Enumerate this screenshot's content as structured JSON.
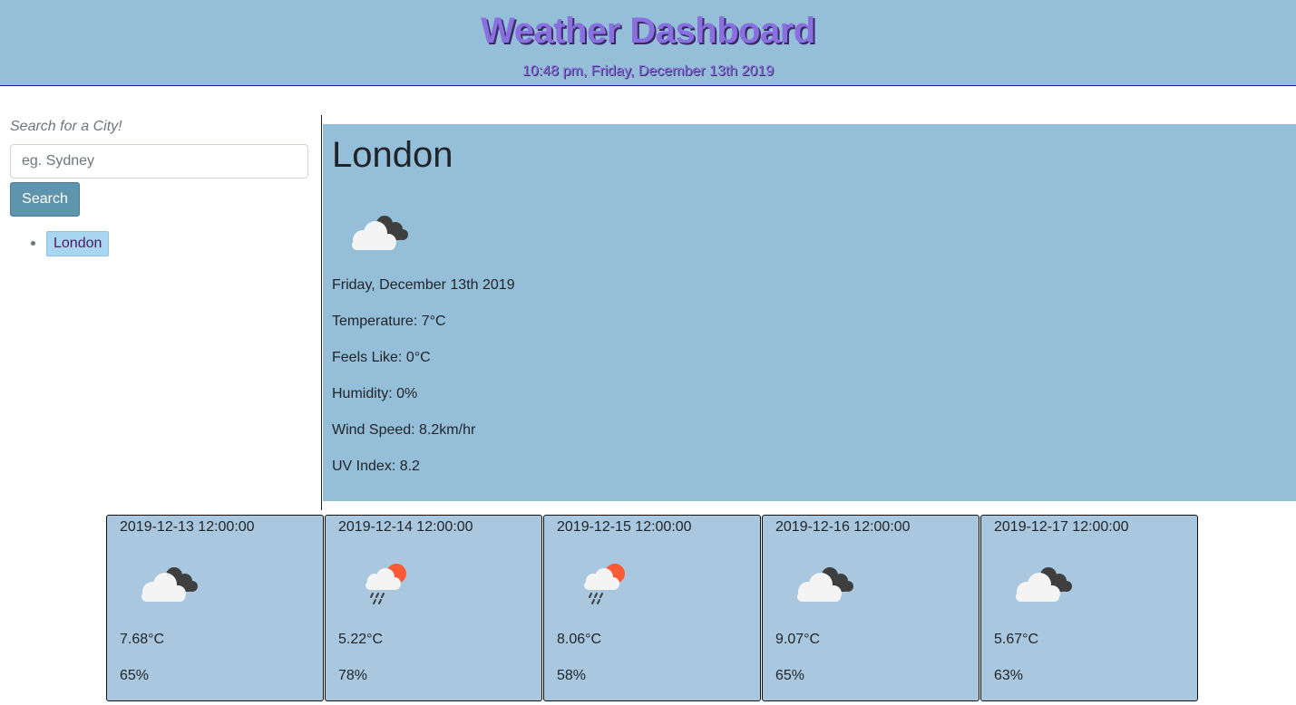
{
  "header": {
    "title": "Weather Dashboard",
    "clock": "10:48 pm, Friday, December 13th 2019"
  },
  "sidebar": {
    "search_label": "Search for a City!",
    "search_placeholder": "eg. Sydney",
    "search_value": "",
    "search_button": "Search",
    "history": [
      {
        "label": "London"
      }
    ]
  },
  "current": {
    "city": "London",
    "icon": "broken-clouds-icon",
    "date": "Friday, December 13th 2019",
    "temperature": "Temperature: 7°C",
    "feels_like": "Feels Like: 0°C",
    "humidity": "Humidity: 0%",
    "wind_speed": "Wind Speed: 8.2km/hr",
    "uv_index": "UV Index: 8.2"
  },
  "forecast": [
    {
      "date": "2019-12-13 12:00:00",
      "icon": "broken-clouds-icon",
      "temp": "7.68°C",
      "humidity": "65%"
    },
    {
      "date": "2019-12-14 12:00:00",
      "icon": "sun-rain-icon",
      "temp": "5.22°C",
      "humidity": "78%"
    },
    {
      "date": "2019-12-15 12:00:00",
      "icon": "sun-rain-icon",
      "temp": "8.06°C",
      "humidity": "58%"
    },
    {
      "date": "2019-12-16 12:00:00",
      "icon": "broken-clouds-icon",
      "temp": "9.07°C",
      "humidity": "65%"
    },
    {
      "date": "2019-12-17 12:00:00",
      "icon": "broken-clouds-icon",
      "temp": "5.67°C",
      "humidity": "63%"
    }
  ],
  "colors": {
    "header_bg": "#95bfd9",
    "title_text": "#8a6fde",
    "panel_bg": "#95bfd9",
    "card_bg": "#a9c8df",
    "button_bg": "#5f94ad",
    "history_bg": "#a8d5f0"
  }
}
